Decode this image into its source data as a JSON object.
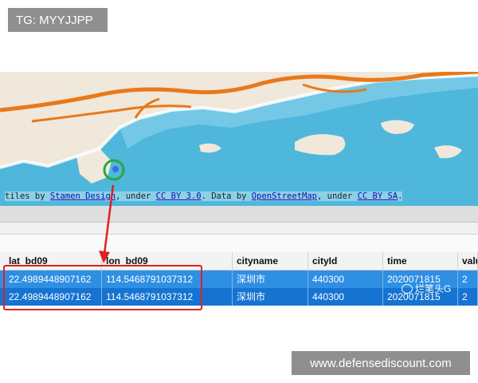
{
  "badge": {
    "text": "TG: MYYJJPP"
  },
  "map": {
    "attribution": {
      "prefix": "tiles by ",
      "link1": "Stamen Design",
      "mid1": ", under ",
      "link2": "CC BY 3.0",
      "mid2": ". Data by ",
      "link3": "OpenStreetMap",
      "mid3": ", under ",
      "link4": "CC BY SA",
      "suffix": "."
    },
    "colors": {
      "water": "#4fb7dc",
      "land": "#f0e8da",
      "road": "#e8791a",
      "marker_ring": "#2aa83a",
      "marker_dot": "#3d6fe0"
    }
  },
  "table": {
    "columns": [
      "lat_bd09",
      "lon_bd09",
      "cityname",
      "cityId",
      "time",
      "valu"
    ],
    "rows": [
      [
        "22.4989448907162",
        "114.5468791037312",
        "深圳市",
        "440300",
        "2020071815",
        "2"
      ],
      [
        "22.4989448907162",
        "114.5468791037312",
        "深圳市",
        "440300",
        "2020071815",
        "2"
      ]
    ]
  },
  "annotations": {
    "highlight_color": "#e02020"
  },
  "watermarks": {
    "wechat": "烂笔头G",
    "site": "www.defensediscount.com"
  }
}
